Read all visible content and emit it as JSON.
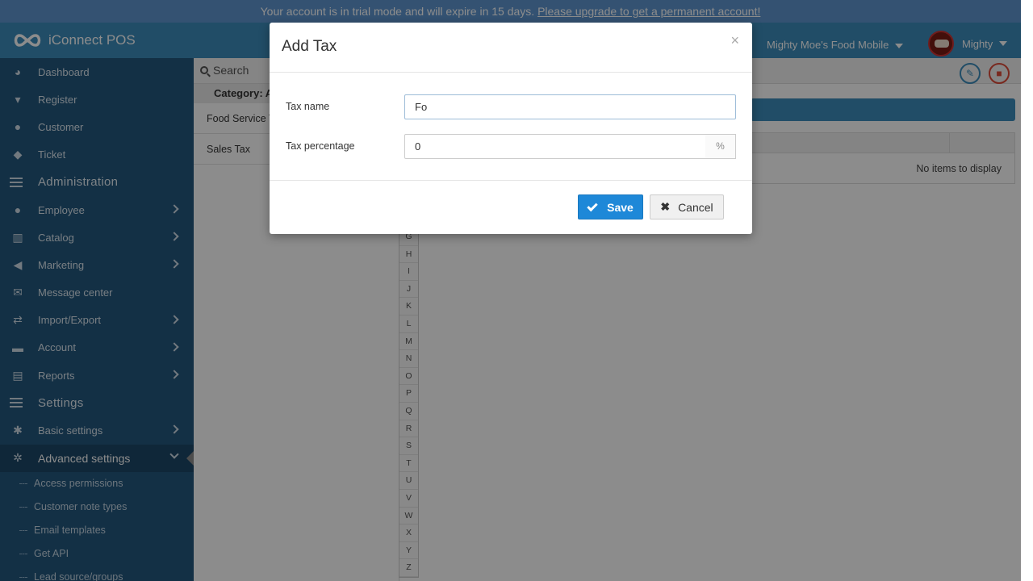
{
  "banner": {
    "text": "Your account is in trial mode and will expire in 15 days.",
    "link": "Please upgrade to get a permanent account!"
  },
  "header": {
    "app_name": "iConnect POS",
    "store_name": "Mighty Moe's Food Mobile",
    "user_name": "Mighty"
  },
  "sidebar": {
    "items": [
      {
        "label": "Dashboard",
        "icon": "dashboard-icon"
      },
      {
        "label": "Register",
        "icon": "cart-icon"
      },
      {
        "label": "Customer",
        "icon": "users-icon"
      },
      {
        "label": "Ticket",
        "icon": "ticket-icon"
      }
    ],
    "admin_header": "Administration",
    "admin_items": [
      {
        "label": "Employee",
        "icon": "user-icon"
      },
      {
        "label": "Catalog",
        "icon": "barcode-icon"
      },
      {
        "label": "Marketing",
        "icon": "megaphone-icon"
      },
      {
        "label": "Message center",
        "icon": "envelope-icon"
      },
      {
        "label": "Import/Export",
        "icon": "exchange-icon"
      },
      {
        "label": "Account",
        "icon": "briefcase-icon"
      },
      {
        "label": "Reports",
        "icon": "chart-icon"
      }
    ],
    "settings_header": "Settings",
    "settings_items": [
      {
        "label": "Basic settings",
        "icon": "gear-icon"
      },
      {
        "label": "Advanced settings",
        "icon": "gears-icon"
      }
    ],
    "sub_items": [
      "Access permissions",
      "Customer note types",
      "Email templates",
      "Get API",
      "Lead source/groups"
    ]
  },
  "main": {
    "search_label": "Search",
    "category_header": "Category: A",
    "categories": [
      "Food Service Tax",
      "Sales Tax"
    ],
    "alphabet": [
      "G",
      "H",
      "I",
      "J",
      "K",
      "L",
      "M",
      "N",
      "O",
      "P",
      "Q",
      "R",
      "S",
      "T",
      "U",
      "V",
      "W",
      "X",
      "Y",
      "Z"
    ],
    "empty_text": "No items to display"
  },
  "modal": {
    "title": "Add Tax",
    "close": "×",
    "tax_name_label": "Tax name",
    "tax_name_value": "Fo",
    "tax_percentage_label": "Tax percentage",
    "tax_percentage_value": "0",
    "percent_symbol": "%",
    "save_label": "Save",
    "cancel_label": "Cancel"
  }
}
